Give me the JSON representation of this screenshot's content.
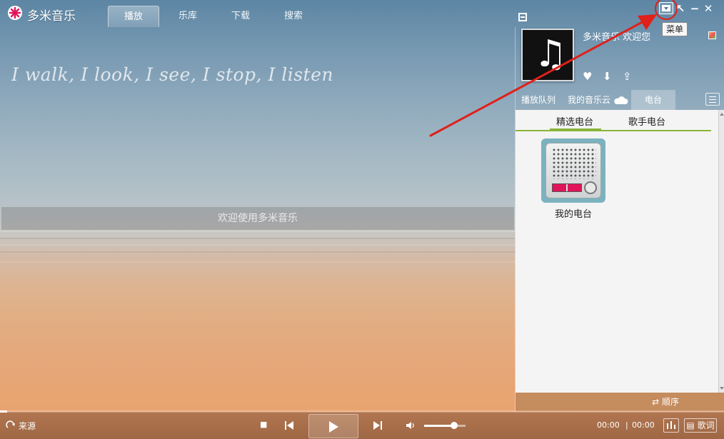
{
  "app": {
    "title": "多米音乐",
    "brand_color": "#e0145a"
  },
  "tabs": [
    {
      "label": "播放",
      "active": true
    },
    {
      "label": "乐库",
      "active": false
    },
    {
      "label": "下载",
      "active": false
    },
    {
      "label": "搜索",
      "active": false
    }
  ],
  "window_controls": {
    "menu_tooltip": "菜单",
    "restore": "↖",
    "minimize": "−",
    "close": "✕"
  },
  "main": {
    "tagline": "I walk, I look, I see, I stop, I listen",
    "welcome": "欢迎使用多米音乐"
  },
  "right_panel": {
    "welcome_user": "多米音乐 欢迎您",
    "actions": {
      "like": "♥",
      "download": "⬇",
      "share": "⇪"
    },
    "tabs": [
      {
        "label": "播放队列",
        "active": false
      },
      {
        "label": "我的音乐云",
        "active": false
      },
      {
        "label": "电台",
        "active": true
      }
    ],
    "subtabs": [
      {
        "label": "精选电台",
        "active": true
      },
      {
        "label": "歌手电台",
        "active": false
      }
    ],
    "radio_item": {
      "label": "我的电台"
    },
    "order": "⇄ 顺序"
  },
  "player": {
    "source": "来源",
    "stop": "■",
    "prev": "⏮",
    "next": "⏭",
    "volume_icon": "🔈",
    "volume_level": 0.72,
    "progress": 0.01,
    "time_current": "00:00",
    "time_total": "00:00",
    "lyrics": "歌词"
  },
  "annotation": {
    "color": "#e0201a"
  }
}
